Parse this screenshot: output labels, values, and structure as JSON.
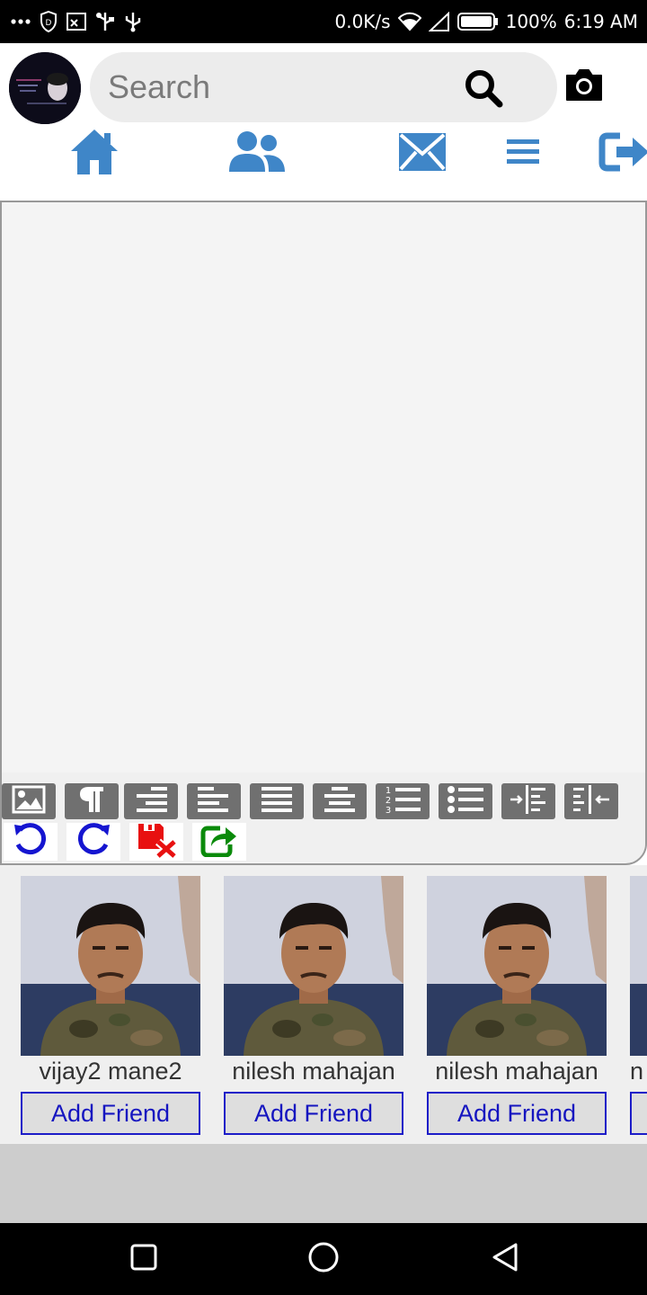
{
  "status_bar": {
    "network_speed": "0.0K/s",
    "battery": "100%",
    "time": "6:19 AM"
  },
  "header": {
    "search": {
      "placeholder": "Search",
      "value": ""
    }
  },
  "nav": {
    "items": [
      "home-icon",
      "friends-icon",
      "messages-icon",
      "menu-icon",
      "logout-icon"
    ],
    "accent_color": "#3f86c8"
  },
  "editor": {
    "toolbar_row1": [
      "image-icon",
      "paragraph-icon",
      "align-right-icon",
      "align-left-icon",
      "align-justify-icon",
      "align-center-icon",
      "ordered-list-icon",
      "unordered-list-icon",
      "indent-icon",
      "outdent-icon"
    ],
    "toolbar_row2": [
      "undo-icon",
      "redo-icon",
      "discard-icon",
      "share-icon"
    ]
  },
  "friends": {
    "add_label": "Add Friend",
    "items": [
      {
        "name": "vijay2 mane2"
      },
      {
        "name": "nilesh mahajan"
      },
      {
        "name": "nilesh mahajan"
      },
      {
        "name": "n"
      }
    ]
  }
}
